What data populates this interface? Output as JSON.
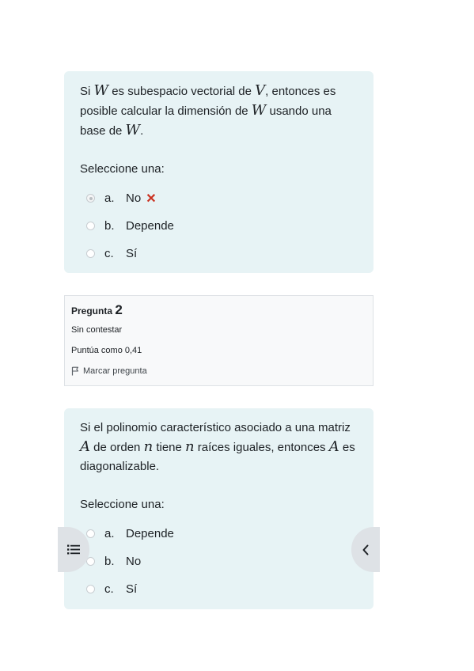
{
  "question1": {
    "stem": {
      "p1": "Si ",
      "m1": "W",
      "p2": " es subespacio vectorial de ",
      "m2": "V",
      "p3": ", entonces es posible calcular la dimensión de ",
      "m3": "W",
      "p4": " usando una base de ",
      "m4": "W",
      "p5": "."
    },
    "prompt": "Seleccione una:",
    "options": [
      {
        "letter": "a.",
        "text": "No",
        "selected": true,
        "feedback": "✕"
      },
      {
        "letter": "b.",
        "text": "Depende"
      },
      {
        "letter": "c.",
        "text": "Sí"
      }
    ]
  },
  "question2_info": {
    "label": "Pregunta",
    "number": "2",
    "status": "Sin contestar",
    "points": "Puntúa como 0,41",
    "flag_label": "Marcar pregunta"
  },
  "question2": {
    "stem": {
      "p1": "Si el polinomio característico asociado a una matriz ",
      "m1": "A",
      "p2": " de orden ",
      "m2": "n",
      "p3": " tiene ",
      "m3": "n",
      "p4": " raíces iguales, entonces ",
      "m4": "A",
      "p5": " es diagonalizable."
    },
    "prompt": "Seleccione una:",
    "options": [
      {
        "letter": "a.",
        "text": "Depende"
      },
      {
        "letter": "b.",
        "text": "No"
      },
      {
        "letter": "c.",
        "text": "Sí"
      }
    ]
  },
  "icons": {
    "drawer": "list-icon",
    "back": "chevron-left-icon",
    "flag": "flag-icon",
    "incorrect": "cross-icon"
  },
  "colors": {
    "question_bg": "#e7f3f5",
    "incorrect": "#ca3120",
    "info_border": "#dee2e6"
  }
}
